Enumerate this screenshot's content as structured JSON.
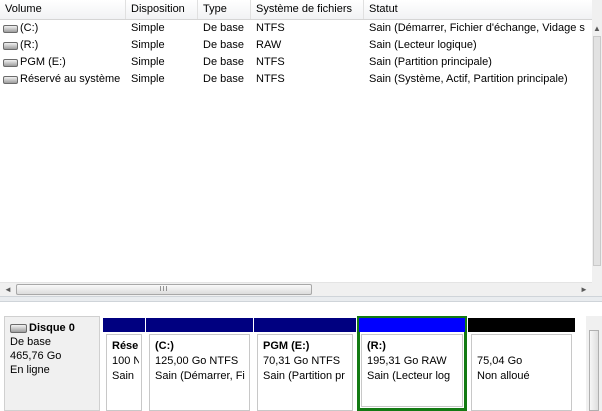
{
  "columns": [
    "Volume",
    "Disposition",
    "Type",
    "Système de fichiers",
    "Statut"
  ],
  "volumes": [
    {
      "name": "(C:)",
      "layout": "Simple",
      "type": "De base",
      "fs": "NTFS",
      "status": "Sain (Démarrer, Fichier d'échange, Vidage s"
    },
    {
      "name": "(R:)",
      "layout": "Simple",
      "type": "De base",
      "fs": "RAW",
      "status": "Sain (Lecteur logique)"
    },
    {
      "name": "PGM (E:)",
      "layout": "Simple",
      "type": "De base",
      "fs": "NTFS",
      "status": "Sain (Partition principale)"
    },
    {
      "name": "Réservé au système",
      "layout": "Simple",
      "type": "De base",
      "fs": "NTFS",
      "status": "Sain (Système, Actif, Partition principale)"
    }
  ],
  "hscroll": {
    "left_arrow": "◄",
    "right_arrow": "►",
    "grip": "III"
  },
  "vscroll": {
    "up_arrow": "▲"
  },
  "disk": {
    "name": "Disque 0",
    "kind": "De base",
    "size": "465,76 Go",
    "state": "En ligne"
  },
  "partitions": [
    {
      "line1": "Rése",
      "line2": "100 N",
      "line3": "Sain",
      "color": "#000080"
    },
    {
      "line1": "(C:)",
      "line2": "125,00 Go NTFS",
      "line3": "Sain (Démarrer, Fi",
      "color": "#000080"
    },
    {
      "line1": "PGM  (E:)",
      "line2": "70,31 Go NTFS",
      "line3": "Sain (Partition pr",
      "color": "#000080"
    },
    {
      "line1": "(R:)",
      "line2": "195,31 Go RAW",
      "line3": "Sain (Lecteur log",
      "color": "#0000ff"
    },
    {
      "line1": "",
      "line2": "75,04 Go",
      "line3": "Non alloué",
      "color": "#000000"
    }
  ]
}
